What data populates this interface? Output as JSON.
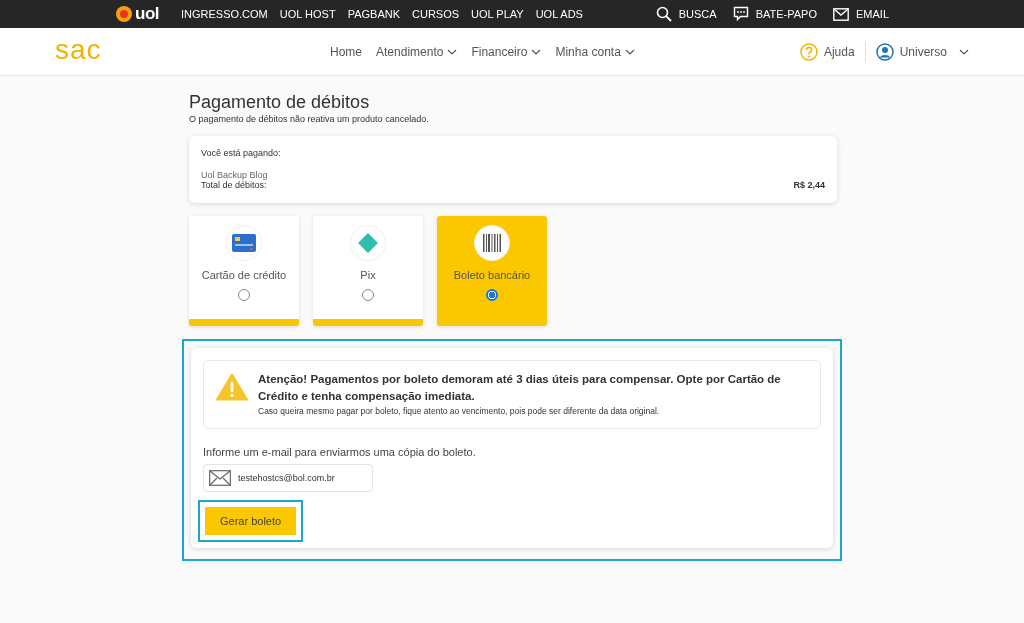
{
  "topbar": {
    "logo": "uol",
    "links": [
      "INGRESSO.COM",
      "UOL HOST",
      "PAGBANK",
      "CURSOS",
      "UOL PLAY",
      "UOL ADS"
    ],
    "actions": [
      {
        "kind": "search",
        "label": "BUSCA"
      },
      {
        "kind": "chat",
        "label": "BATE-PAPO"
      },
      {
        "kind": "mail",
        "label": "EMAIL"
      }
    ]
  },
  "header": {
    "logo": "sac",
    "nav": [
      {
        "label": "Home",
        "dropdown": false
      },
      {
        "label": "Atendimento",
        "dropdown": true
      },
      {
        "label": "Financeiro",
        "dropdown": true
      },
      {
        "label": "Minha conta",
        "dropdown": true
      }
    ],
    "help": "Ajuda",
    "user": "Universo"
  },
  "page": {
    "title": "Pagamento de débitos",
    "subtitle": "O pagamento de débitos não reativa um produto cancelado."
  },
  "summary": {
    "heading": "Você está pagando:",
    "product": "Uol Backup Blog",
    "total_label": "Total de débitos:",
    "total": "R$ 2,44"
  },
  "methods": [
    {
      "kind": "card",
      "label": "Cartão de crédito",
      "selected": false
    },
    {
      "kind": "pix",
      "label": "Pix",
      "selected": false
    },
    {
      "kind": "barcode",
      "label": "Boleto bancário",
      "selected": true
    }
  ],
  "boleto": {
    "warning_title": "Atenção! Pagamentos por boleto demoram até 3 dias úteis para compensar. Opte por Cartão de Crédito e tenha compensação imediata.",
    "warning_text": "Caso queira mesmo pagar por boleto, fique atento ao vencimento, pois pode ser diferente da data original.",
    "email_label": "Informe um e-mail para enviarmos uma cópia do boleto.",
    "email": "testehostcs@bol.com.br",
    "button": "Gerar boleto"
  }
}
